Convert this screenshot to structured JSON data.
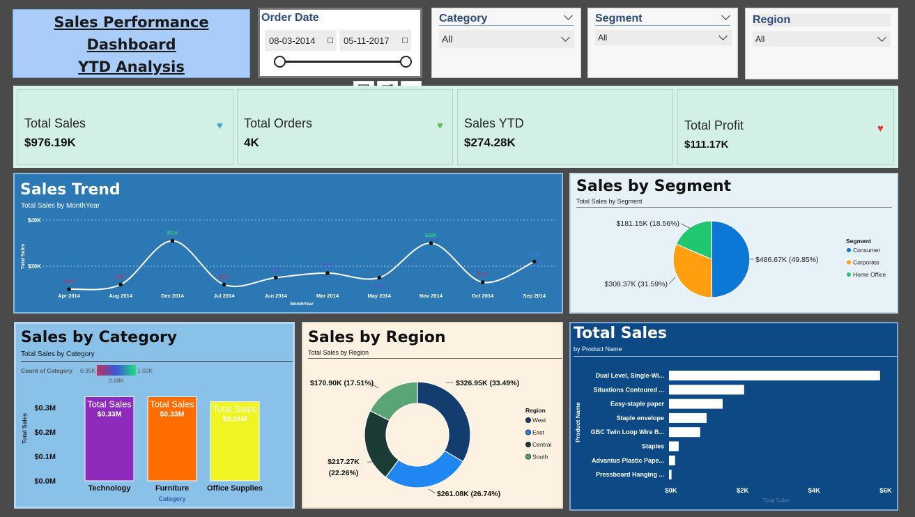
{
  "title": {
    "line1": "Sales Performance Dashboard ",
    "line2": "YTD Analysis"
  },
  "order_date": {
    "label": "Order Date",
    "start": "08-03-2014",
    "end": "05-11-2017"
  },
  "slicers": [
    {
      "label": "Category",
      "value": "All"
    },
    {
      "label": "Segment",
      "value": "All"
    },
    {
      "label": "Region",
      "value": "All"
    }
  ],
  "visual_tools": [
    "filter-icon",
    "expand-icon",
    "more-options-icon"
  ],
  "kpis": [
    {
      "label": "Total Sales",
      "value": "$976.19K",
      "icon": "heart-blue",
      "color": "#4aa3df"
    },
    {
      "label": "Total Orders",
      "value": "4K",
      "icon": "heart-green",
      "color": "#5cc14a"
    },
    {
      "label": "Sales YTD",
      "value": "$274.28K",
      "icon": "",
      "color": ""
    },
    {
      "label": "Total Profit",
      "value": "$111.17K",
      "icon": "heart-red",
      "color": "#e8323c"
    }
  ],
  "sales_trend": {
    "title": "Sales Trend",
    "subtitle": "Total Sales by MonthYear",
    "xlabel": "MonthYear",
    "ylabel": "Total Sales",
    "yticks": [
      "$40K",
      "$20K"
    ]
  },
  "segment": {
    "title": "Sales by Segment",
    "subtitle": "Total Sales by Segment",
    "legend_title": "Segment"
  },
  "category": {
    "title": "Sales by Category",
    "subtitle": "Total Sales by Category",
    "legend_title": "Count of Category",
    "legend_min": "0.35K",
    "legend_max": "1.02K",
    "legend_mid": "0.68K",
    "xlabel": "Category",
    "ylabel": "Total Sales",
    "yticks": [
      "$0.3M",
      "$0.2M",
      "$0.1M",
      "$0.0M"
    ]
  },
  "region": {
    "title": "Sales by Region",
    "subtitle": "Total Sales by Region",
    "legend_title": "Region"
  },
  "product": {
    "title": "Total Sales",
    "subtitle": "by Product Name",
    "xlabel": "Total Sales",
    "ylabel": "Product Name",
    "xticks": [
      "$0K",
      "$2K",
      "$4K",
      "$6K"
    ]
  },
  "chart_data": [
    {
      "type": "line",
      "title": "Sales Trend",
      "x": [
        "Apr 2014",
        "Aug 2014",
        "Dec 2014",
        "Jul 2014",
        "Jun 2014",
        "Mar 2014",
        "May 2014",
        "Nov 2014",
        "Oct 2014",
        "Sep 2014"
      ],
      "values": [
        10,
        12,
        31,
        12,
        15,
        17,
        15,
        30,
        13,
        22
      ],
      "labels": [
        "$10K",
        "$12K",
        "$31K",
        "$12K",
        "$15K",
        "$17K",
        "$15K",
        "$30K",
        "$13K",
        "$22K"
      ],
      "label_colors": [
        "#c0335a",
        "#c0335a",
        "#3df06c",
        "#c0335a",
        "#6a4bd6",
        "#6a4bd6",
        "#6a4bd6",
        "#3df06c",
        "#c0335a",
        "#4f7fe0"
      ],
      "ylim": [
        0,
        40
      ]
    },
    {
      "type": "pie",
      "title": "Sales by Segment",
      "categories": [
        "Consumer",
        "Corporate",
        "Home Office"
      ],
      "values": [
        486.67,
        308.37,
        181.15
      ],
      "labels": [
        "$486.67K (49.85%)",
        "$308.37K (31.59%)",
        "$181.15K (18.56%)"
      ],
      "colors": [
        "#0a78d4",
        "#ff9f0f",
        "#1fc76e"
      ]
    },
    {
      "type": "bar",
      "title": "Sales by Category",
      "categories": [
        "Technology",
        "Furniture",
        "Office Supplies"
      ],
      "values": [
        0.33,
        0.33,
        0.31
      ],
      "labels": [
        "$0.33M",
        "$0.33M",
        "$0.31M"
      ],
      "bar_text": "Total Sales",
      "colors": [
        "#8e2bbd",
        "#ff6c00",
        "#eef520"
      ],
      "ylim": [
        0,
        0.3
      ]
    },
    {
      "type": "pie",
      "title": "Sales by Region",
      "categories": [
        "West",
        "East",
        "Central",
        "South"
      ],
      "values": [
        326.95,
        261.08,
        217.27,
        170.9
      ],
      "labels": [
        "$326.95K (33.49%)",
        "$261.08K (26.74%)",
        "$217.27K (22.26%)",
        "$170.90K (17.51%)"
      ],
      "colors": [
        "#133d6e",
        "#1f86f2",
        "#1b3b34",
        "#5aa575"
      ]
    },
    {
      "type": "bar",
      "title": "Total Sales",
      "categories": [
        "Dual Level, Single-Wi...",
        "Situations Contoured ...",
        "Easy-staple paper",
        "Staple envelope",
        "GBC Twin Loop Wire B...",
        "Staples",
        "Advantus Plastic Pape...",
        "Pressboard Hanging ..."
      ],
      "values": [
        5.9,
        2.1,
        1.5,
        1.05,
        0.87,
        0.27,
        0.17,
        0.07
      ],
      "xlim": [
        0,
        6
      ]
    }
  ]
}
